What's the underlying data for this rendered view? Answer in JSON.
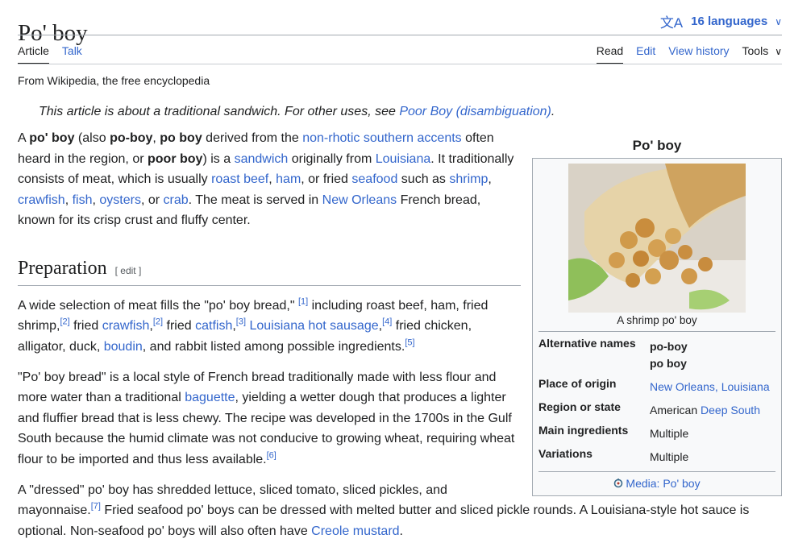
{
  "page": {
    "title": "Po' boy",
    "languages_label": "16 languages",
    "tagline": "From Wikipedia, the free encyclopedia"
  },
  "tabs": {
    "left": [
      "Article",
      "Talk"
    ],
    "right": [
      "Read",
      "Edit",
      "View history",
      "Tools"
    ]
  },
  "hatnote": {
    "text": "This article is about a traditional sandwich. For other uses, see ",
    "link": "Poor Boy (disambiguation)",
    "end": "."
  },
  "intro": {
    "s1": "A ",
    "b1": "po' boy",
    "s2": " (also ",
    "b2": "po-boy",
    "s3": ", ",
    "b3": "po boy",
    "s4": " derived from the ",
    "l1": "non-rhotic southern accents",
    "s5": " often heard in the region, or ",
    "b4": "poor boy",
    "s6": ") is a ",
    "l2": "sandwich",
    "s7": " originally from ",
    "l3": "Louisiana",
    "s8": ". It traditionally consists of meat, which is usually ",
    "l4": "roast beef",
    "s9": ", ",
    "l5": "ham",
    "s10": ", or fried ",
    "l6": "seafood",
    "s11": " such as ",
    "l7": "shrimp",
    "s12": ", ",
    "l8": "crawfish",
    "s13": ", ",
    "l9": "fish",
    "s14": ", ",
    "l10": "oysters",
    "s15": ", or ",
    "l11": "crab",
    "s16": ". The meat is served in ",
    "l12": "New Orleans",
    "s17": " French bread, known for its crisp crust and fluffy center."
  },
  "preparation": {
    "heading": "Preparation",
    "edit": "[ edit ]",
    "p1": {
      "s1": "A wide selection of meat fills the \"po' boy bread,\" ",
      "r1": "[1]",
      "s2": " including roast beef, ham, fried shrimp,",
      "r2": "[2]",
      "s3": " fried ",
      "l1": "crawfish",
      "r3": "[2]",
      "s4": " fried ",
      "l2": "catfish",
      "r4": "[3]",
      "s5": " ",
      "l3": "Louisiana hot sausage",
      "r5": "[4]",
      "s6": " fried chicken, alligator, duck, ",
      "l4": "boudin",
      "s7": ", and rabbit listed among possible ingredients.",
      "r6": "[5]"
    },
    "p2": {
      "s1": "\"Po' boy bread\" is a local style of French bread traditionally made with less flour and more water than a traditional ",
      "l1": "baguette",
      "s2": ", yielding a wetter dough that produces a lighter and fluffier bread that is less chewy. The recipe was developed in the 1700s in the Gulf South because the humid climate was not conducive to growing wheat, requiring wheat flour to be imported and thus less available.",
      "r1": "[6]"
    },
    "p3": {
      "s1": "A \"dressed\" po' boy has shredded lettuce, sliced tomato, sliced pickles, and",
      "s2": "mayonnaise.",
      "r1": "[7]",
      "s3": " Fried seafood po' boys can be dressed with melted butter and sliced pickle rounds. A Louisiana-style hot sauce is optional. Non-seafood po' boys will also often have ",
      "l1": "Creole mustard",
      "s4": "."
    }
  },
  "infobox": {
    "title": "Po' boy",
    "caption": "A shrimp po' boy",
    "rows": [
      {
        "label": "Alternative names",
        "value": "po-boy",
        "value2": "po boy"
      },
      {
        "label": "Place of origin",
        "value": "New Orleans, Louisiana"
      },
      {
        "label": "Region or state",
        "value": "American ",
        "link": "Deep South"
      },
      {
        "label": "Main ingredients",
        "value": "Multiple"
      },
      {
        "label": "Variations",
        "value": "Multiple"
      }
    ],
    "footer": "Media: Po' boy"
  },
  "colors": {
    "link": "#3366cc",
    "text": "#202122",
    "border": "#a2a9b1",
    "infobox_bg": "#f8f9fa"
  },
  "icons": {
    "languages": "translate-icon",
    "chevron": "chevron-down-icon",
    "media": "commons-icon"
  }
}
